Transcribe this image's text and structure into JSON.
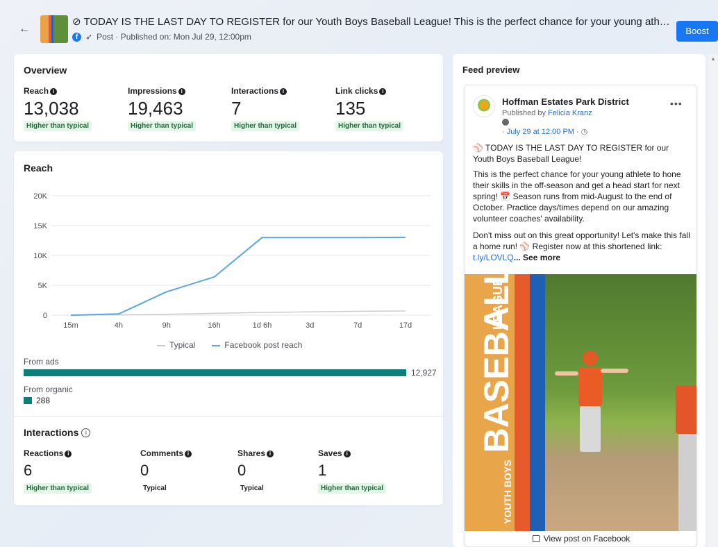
{
  "header": {
    "title": "⊘ TODAY IS THE LAST DAY TO REGISTER for our Youth Boys Baseball League! This is the perfect chance for your young athlete to h...",
    "subtitle": "Post · Published on: Mon Jul 29, 12:00pm",
    "boost_label": "Boost"
  },
  "overview": {
    "title": "Overview",
    "metrics": [
      {
        "label": "Reach",
        "value": "13,038",
        "badge": "Higher than typical"
      },
      {
        "label": "Impressions",
        "value": "19,463",
        "badge": "Higher than typical"
      },
      {
        "label": "Interactions",
        "value": "7",
        "badge": "Higher than typical"
      },
      {
        "label": "Link clicks",
        "value": "135",
        "badge": "Higher than typical"
      }
    ]
  },
  "reach": {
    "title": "Reach",
    "from_ads_label": "From ads",
    "from_ads_value": "12,927",
    "from_organic_label": "From organic",
    "from_organic_value": "288"
  },
  "chart_data": {
    "type": "line",
    "title": "Reach",
    "x_ticks": [
      "15m",
      "4h",
      "9h",
      "16h",
      "1d 6h",
      "3d",
      "7d",
      "17d"
    ],
    "y_ticks": [
      "0",
      "5K",
      "10K",
      "15K",
      "20K"
    ],
    "ylim": [
      0,
      20000
    ],
    "grid": true,
    "legend_position": "bottom",
    "series": [
      {
        "name": "Typical",
        "color": "#c9ccd1",
        "values": [
          0,
          50,
          150,
          300,
          450,
          550,
          650,
          700
        ]
      },
      {
        "name": "Facebook post reach",
        "color": "#5aa7dc",
        "values": [
          0,
          200,
          3900,
          6400,
          13000,
          13000,
          13000,
          13038
        ]
      }
    ]
  },
  "interactions": {
    "title": "Interactions",
    "metrics": [
      {
        "label": "Reactions",
        "value": "6",
        "badge": "Higher than typical"
      },
      {
        "label": "Comments",
        "value": "0",
        "badge": "Typical"
      },
      {
        "label": "Shares",
        "value": "0",
        "badge": "Typical"
      },
      {
        "label": "Saves",
        "value": "1",
        "badge": "Higher than typical"
      }
    ]
  },
  "preview": {
    "title": "Feed preview",
    "page_name": "Hoffman Estates Park District",
    "published_by_prefix": "Published by ",
    "published_by": "Felicia Kranz",
    "date": "· July 29 at 12:00 PM ·",
    "para1": "⚾ TODAY IS THE LAST DAY TO REGISTER for our Youth Boys Baseball League!",
    "para2": "This is the perfect chance for your young athlete to hone their skills in the off-season and get a head start for next spring! 📅 Season runs from mid-August to the end of October. Practice days/times depend on our amazing volunteer coaches' availability.",
    "para3": "Don't miss out on this great opportunity! Let's make this fall a home run! ⚾ Register now at this shortened link: ",
    "link": "t.ly/LOVLQ",
    "see_more": "... See more",
    "image_text_small": "YOUTH BOYS",
    "image_text_big": "BASEBALL",
    "image_text_league": "LEAGUE",
    "view_on_facebook": "View post on Facebook"
  }
}
